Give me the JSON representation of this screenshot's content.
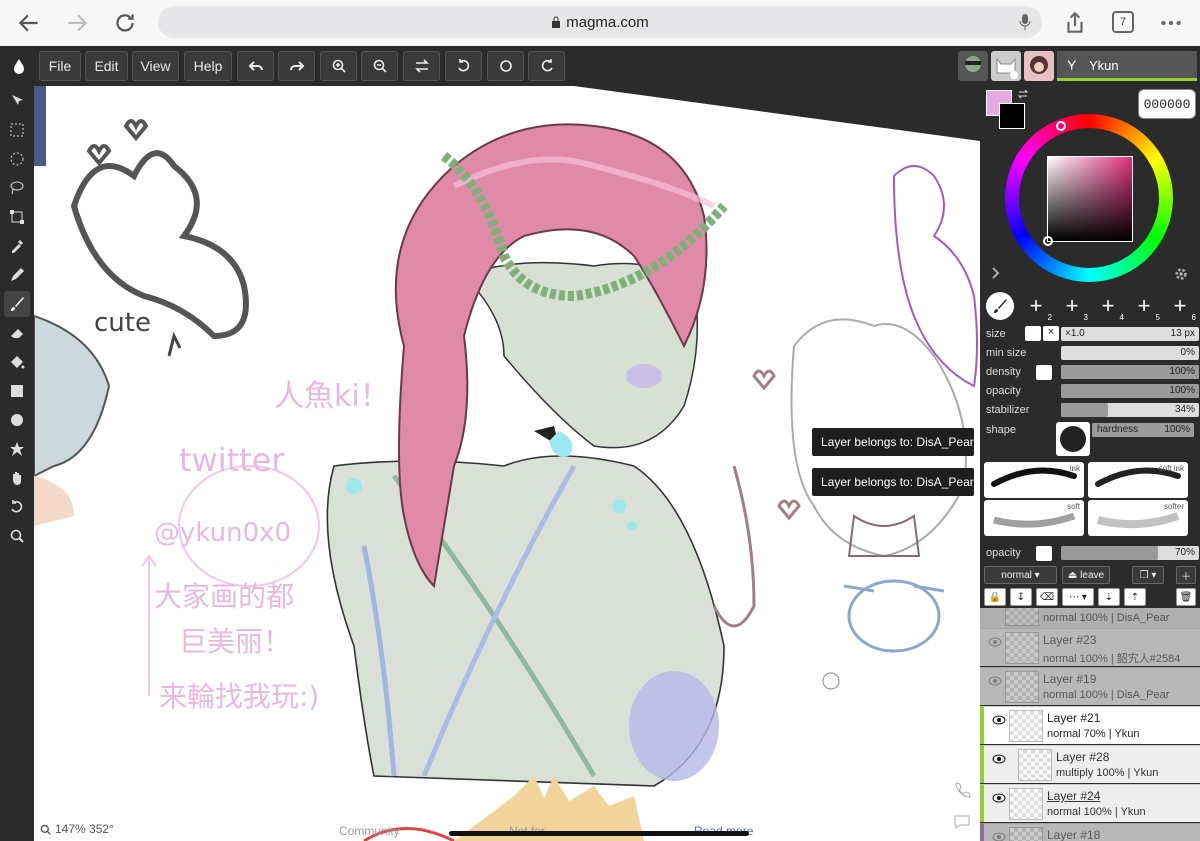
{
  "browser": {
    "url": "magma.com",
    "tab_count": "7"
  },
  "toolbar": {
    "file": "File",
    "edit": "Edit",
    "view": "View",
    "help": "Help",
    "user": "Ykun",
    "user_initial": "Y"
  },
  "color": {
    "hex": "000000",
    "primary": "#e8a9e0",
    "secondary": "#000000"
  },
  "brush": {
    "size_label": "size",
    "size_mult": "×1.0",
    "size_value": "13 px",
    "min_size_label": "min size",
    "min_size_value": "0%",
    "min_size_fraction": 0.0,
    "density_label": "density",
    "density_value": "100%",
    "density_fraction": 1.0,
    "opacity_label": "opacity",
    "opacity_value": "100%",
    "opacity_fraction": 1.0,
    "stabilizer_label": "stabilizer",
    "stabilizer_value": "34%",
    "stabilizer_fraction": 0.34,
    "shape_label": "shape",
    "hardness_label": "hardness",
    "hardness_value": "100%",
    "slots": [
      "1",
      "2",
      "3",
      "4",
      "5",
      "6"
    ],
    "presets": [
      "ink",
      "soft ink",
      "soft",
      "softer"
    ]
  },
  "layer_opacity": {
    "label": "opacity",
    "value": "70%",
    "fraction": 0.7
  },
  "layer_controls": {
    "blend": "normal",
    "leave": "leave"
  },
  "tooltips": [
    "Layer belongs to: DisA_Pear",
    "Layer belongs to: DisA_Pear"
  ],
  "layers": [
    {
      "name": "",
      "meta": "normal 100% | DisA_Pear"
    },
    {
      "name": "Layer #23",
      "meta": "normal 100% | 韶宄人#2584"
    },
    {
      "name": "Layer #19",
      "meta": "normal 100% | DisA_Pear"
    },
    {
      "name": "Layer #21",
      "meta": "normal 70% | Ykun"
    },
    {
      "name": "Layer #28",
      "meta": "multiply 100% | Ykun"
    },
    {
      "name": "Layer #24",
      "meta": "normal 100% | Ykun"
    },
    {
      "name": "Layer #18",
      "meta": ""
    }
  ],
  "status": {
    "zoom": "147% 352°",
    "community": "Community",
    "not_for": "Not for",
    "read_more": "Read more"
  },
  "canvas_text": {
    "cute": "cute",
    "twitter": "twitter",
    "handle": "@ykun0x0",
    "ayu": "人魚ki！",
    "cn1": "大家画的都",
    "cn2": "巨美丽！",
    "cn3": "来輪找我玩:)"
  }
}
